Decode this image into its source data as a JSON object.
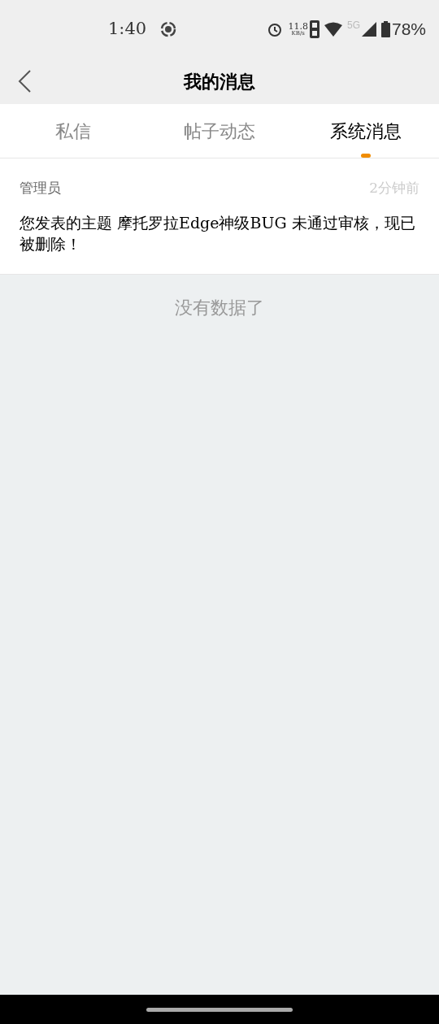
{
  "status_bar": {
    "time": "1:40",
    "net_speed": "11.8",
    "net_unit": "KB/s",
    "network": "5G",
    "battery": "78%"
  },
  "header": {
    "title": "我的消息"
  },
  "tabs": [
    {
      "label": "私信",
      "selected": false
    },
    {
      "label": "帖子动态",
      "selected": false
    },
    {
      "label": "系统消息",
      "selected": true
    }
  ],
  "messages": [
    {
      "sender": "管理员",
      "time": "2分钟前",
      "body": "您发表的主题 摩托罗拉Edge神级BUG 未通过审核，现已被删除！"
    }
  ],
  "end_text": "没有数据了"
}
